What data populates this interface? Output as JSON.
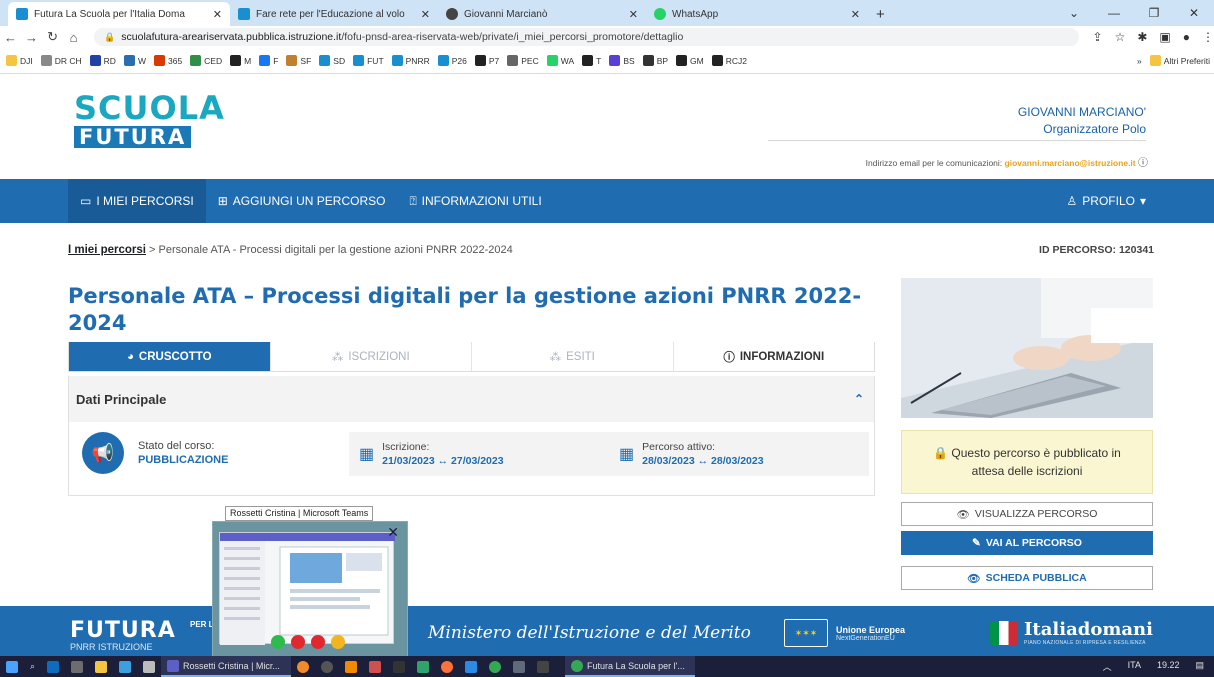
{
  "browser": {
    "tabs": [
      {
        "title": "Futura La Scuola per l'Italia Doma",
        "color": "#1a8fd0"
      },
      {
        "title": "Fare rete per l'Educazione al volo",
        "color": "#1a8fd0"
      },
      {
        "title": "Giovanni Marcianò",
        "color": "#444444"
      },
      {
        "title": "WhatsApp",
        "color": "#25d366"
      }
    ],
    "new_tab": "+",
    "url_domain": "scuolafutura-areariservata.pubblica.istruzione.it",
    "url_path": "/fofu-pnsd-area-riservata-web/private/i_miei_percorsi_promotore/dettaglio",
    "bookmarks": [
      {
        "label": "DJI",
        "color": "#f5c542"
      },
      {
        "label": "DR CH",
        "color": "#888888"
      },
      {
        "label": "RD",
        "color": "#2140a8"
      },
      {
        "label": "W",
        "color": "#2a6db0"
      },
      {
        "label": "365",
        "color": "#d83b01"
      },
      {
        "label": "CED",
        "color": "#2f8f46"
      },
      {
        "label": "M",
        "color": "#222222"
      },
      {
        "label": "F",
        "color": "#1877f2"
      },
      {
        "label": "SF",
        "color": "#c08030"
      },
      {
        "label": "SD",
        "color": "#1a8fd0"
      },
      {
        "label": "FUT",
        "color": "#1a8fd0"
      },
      {
        "label": "PNRR",
        "color": "#1a8fd0"
      },
      {
        "label": "P26",
        "color": "#1a8fd0"
      },
      {
        "label": "P7",
        "color": "#222222"
      },
      {
        "label": "PEC",
        "color": "#666666"
      },
      {
        "label": "WA",
        "color": "#25d366"
      },
      {
        "label": "T",
        "color": "#222222"
      },
      {
        "label": "BS",
        "color": "#5a3fd6"
      },
      {
        "label": "BP",
        "color": "#333333"
      },
      {
        "label": "GM",
        "color": "#222222"
      },
      {
        "label": "RCJ2",
        "color": "#222222"
      }
    ],
    "more": "»",
    "other_bookmarks": "Altri Preferiti"
  },
  "header": {
    "logo_line1": "SCUOLA",
    "logo_line2": "FUTURA",
    "user_name": "GIOVANNI MARCIANO'",
    "user_role": "Organizzatore Polo",
    "email_label": "Indirizzo email per le comunicazioni:",
    "email": "giovanni.marciano@istruzione.it"
  },
  "nav": {
    "items": [
      "I MIEI PERCORSI",
      "AGGIUNGI UN PERCORSO",
      "INFORMAZIONI UTILI"
    ],
    "profile": "PROFILO"
  },
  "breadcrumb": {
    "link": "I miei percorsi",
    "separator": ">",
    "current": "Personale ATA - Processi digitali per la gestione azioni PNRR 2022-2024"
  },
  "id_percorso": "ID PERCORSO: 120341",
  "title": "Personale ATA – Processi digitali per la gestione azioni PNRR 2022-2024",
  "tabs": [
    "CRUSCOTTO",
    "ISCRIZIONI",
    "ESITI",
    "INFORMAZIONI"
  ],
  "panel": {
    "title": "Dati Principale",
    "stato_label": "Stato del corso:",
    "stato_value": "PUBBLICAZIONE",
    "iscrizione_label": "Iscrizione:",
    "iscrizione_value": "21/03/2023 ↔ 27/03/2023",
    "attivo_label": "Percorso attivo:",
    "attivo_value": "28/03/2023 ↔ 28/03/2023"
  },
  "sidebar": {
    "notice": "Questo percorso è pubblicato in attesa delle iscrizioni",
    "btn_view": "VISUALIZZA PERCORSO",
    "btn_go": "VAI AL PERCORSO",
    "btn_public": "SCHEDA PUBBLICA"
  },
  "footer": {
    "brand": "FUTURA",
    "brand_sub": "PNRR ISTRUZIONE",
    "brand_tag": "PER L",
    "ministero": "Ministero dell'Istruzione e del Merito",
    "eu_line1": "Unione Europea",
    "eu_line2": "NextGenerationEU",
    "italia_domani": "Italiadomani",
    "italia_sub": "PIANO NAZIONALE DI RIPRESA E RESILIENZA"
  },
  "teams_preview": {
    "tooltip": "Rossetti Cristina | Microsoft Teams"
  },
  "taskbar": {
    "window1": "Rossetti Cristina | Micr...",
    "window2": "Futura La Scuola per l'...",
    "lang": "ITA",
    "time": "19.22"
  }
}
